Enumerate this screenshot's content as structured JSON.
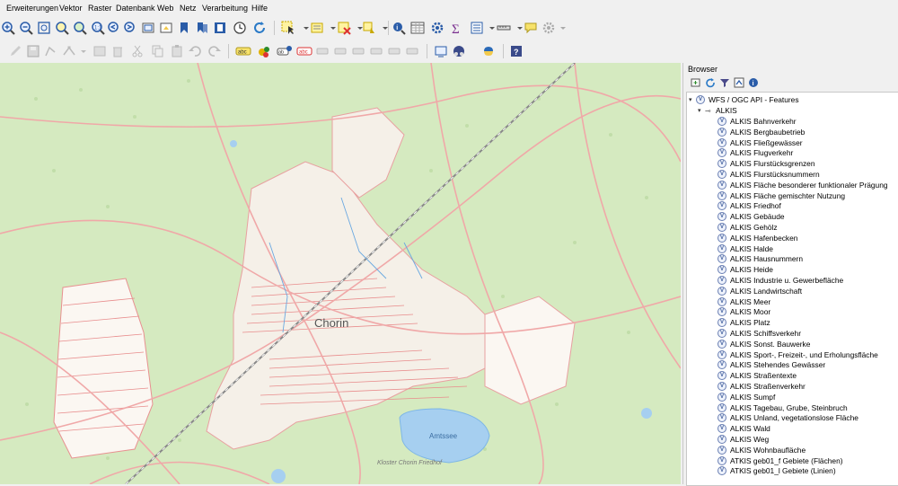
{
  "menubar": {
    "items": [
      "Erweiterungen",
      "Vektor",
      "Raster",
      "Datenbank",
      "Web",
      "Netz",
      "Verarbeitung",
      "Hilfe"
    ]
  },
  "toolbar1": {
    "icons": [
      "zoom-in-icon",
      "zoom-out-icon",
      "zoom-full-icon",
      "zoom-selection-icon",
      "zoom-layer-icon",
      "zoom-native-icon",
      "zoom-last-icon",
      "zoom-next-icon",
      "new-map-view-icon",
      "new-3d-view-icon",
      "new-bookmark-icon",
      "show-bookmarks-icon",
      "temporal-controller-icon",
      "refresh-icon",
      "select-feature-icon",
      "select-value-icon",
      "deselect-icon",
      "identify-icon",
      "attribute-table-icon",
      "toolbox-icon",
      "statistics-icon",
      "field-calculator-icon",
      "measure-icon",
      "annotation-icon",
      "settings-icon"
    ]
  },
  "toolbar2": {
    "icons": [
      "edit-pencil-icon",
      "save-edits-icon",
      "digitize-icon",
      "vertex-tool-icon",
      "delete-selected-icon",
      "cut-icon",
      "copy-icon",
      "paste-icon",
      "undo-icon",
      "redo-icon",
      "label-icon",
      "label-pin-icon",
      "label-show-icon",
      "label-move-icon",
      "label-change-icon",
      "georef-icon",
      "python-icon",
      "help-icon",
      "plugin-icon"
    ]
  },
  "map": {
    "place_label": "Chorin",
    "lake_label": "Amtssee",
    "secondary_label": "Kloster Chorin Friedhof"
  },
  "browser": {
    "title": "Browser",
    "root": "WFS / OGC API - Features",
    "group": "ALKIS",
    "layers": [
      "ALKIS Bahnverkehr",
      "ALKIS Bergbaubetrieb",
      "ALKIS Fließgewässer",
      "ALKIS Flugverkehr",
      "ALKIS Flurstücksgrenzen",
      "ALKIS Flurstücksnummern",
      "ALKIS Fläche besonderer funktionaler Prägung",
      "ALKIS Fläche gemischter Nutzung",
      "ALKIS Friedhof",
      "ALKIS Gebäude",
      "ALKIS Gehölz",
      "ALKIS Hafenbecken",
      "ALKIS Halde",
      "ALKIS Hausnummern",
      "ALKIS Heide",
      "ALKIS Industrie u. Gewerbefläche",
      "ALKIS Landwirtschaft",
      "ALKIS Meer",
      "ALKIS Moor",
      "ALKIS Platz",
      "ALKIS Schiffsverkehr",
      "ALKIS Sonst. Bauwerke",
      "ALKIS Sport-, Freizeit-, und Erholungsfläche",
      "ALKIS Stehendes Gewässer",
      "ALKIS Straßentexte",
      "ALKIS Straßenverkehr",
      "ALKIS Sumpf",
      "ALKIS Tagebau, Grube, Steinbruch",
      "ALKIS Unland, vegetationslose Fläche",
      "ALKIS Wald",
      "ALKIS Weg",
      "ALKIS Wohnbaufläche",
      "ATKIS geb01_f Gebiete (Flächen)",
      "ATKIS geb01_l Gebiete (Linien)"
    ]
  }
}
